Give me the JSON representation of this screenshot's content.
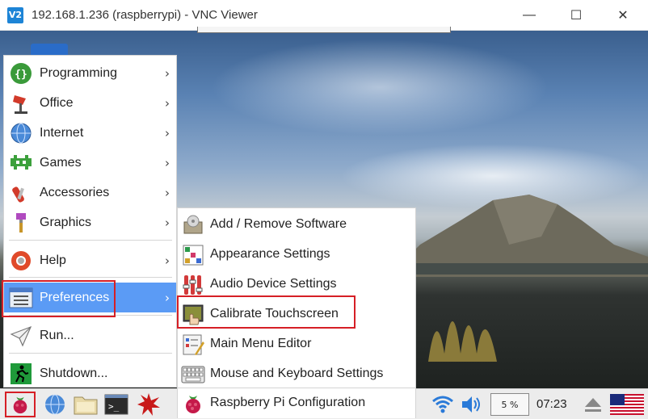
{
  "window": {
    "title": "192.168.1.236 (raspberrypi) - VNC Viewer",
    "logo_text": "V2",
    "minimize_glyph": "—",
    "maximize_glyph": "☐",
    "close_glyph": "✕"
  },
  "main_menu": {
    "items": [
      {
        "label": "Programming",
        "icon": "programming-icon",
        "has_submenu": true
      },
      {
        "label": "Office",
        "icon": "office-icon",
        "has_submenu": true
      },
      {
        "label": "Internet",
        "icon": "internet-icon",
        "has_submenu": true
      },
      {
        "label": "Games",
        "icon": "games-icon",
        "has_submenu": true
      },
      {
        "label": "Accessories",
        "icon": "accessories-icon",
        "has_submenu": true
      },
      {
        "label": "Graphics",
        "icon": "graphics-icon",
        "has_submenu": true
      },
      {
        "label": "Help",
        "icon": "help-icon",
        "has_submenu": true
      },
      {
        "label": "Preferences",
        "icon": "preferences-icon",
        "has_submenu": true,
        "active": true
      },
      {
        "label": "Run...",
        "icon": "run-icon",
        "has_submenu": false
      },
      {
        "label": "Shutdown...",
        "icon": "shutdown-icon",
        "has_submenu": false
      }
    ],
    "chevron": "›"
  },
  "sub_menu": {
    "items": [
      {
        "label": "Add / Remove Software",
        "icon": "software-icon"
      },
      {
        "label": "Appearance Settings",
        "icon": "appearance-icon"
      },
      {
        "label": "Audio Device Settings",
        "icon": "audio-icon"
      },
      {
        "label": "Calibrate Touchscreen",
        "icon": "touchscreen-icon",
        "highlighted": true
      },
      {
        "label": "Main Menu Editor",
        "icon": "menu-editor-icon"
      },
      {
        "label": "Mouse and Keyboard Settings",
        "icon": "keyboard-icon"
      },
      {
        "label": "Raspberry Pi Configuration",
        "icon": "raspberry-config-icon"
      }
    ]
  },
  "taskbar": {
    "cpu": "5 %",
    "clock": "07:23",
    "terminal_text": ">_"
  },
  "colors": {
    "highlight_red": "#d61f26",
    "menu_active": "#5b9bf5",
    "vnc_blue": "#1d84d6"
  }
}
